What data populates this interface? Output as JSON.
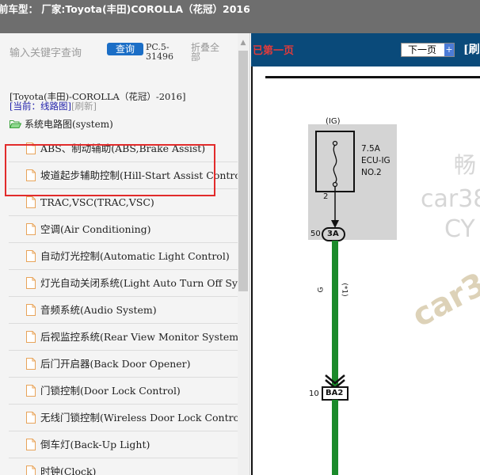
{
  "title": "前车型： 厂家:Toyota(丰田)COROLLA（花冠）2016",
  "search": {
    "placeholder": "输入关键字查询",
    "button": "查询",
    "pc_label": "PC.5-31496",
    "collapse_all": "折叠全部"
  },
  "breadcrumb": {
    "path": "[Toyota(丰田)-COROLLA（花冠）-2016]",
    "current": "[当前：线路图]",
    "refresh": "[刷新]"
  },
  "tree": {
    "root": "系统电路图(system)",
    "items": [
      "ABS、制动辅助(ABS,Brake Assist)",
      "坡道起步辅助控制(Hill-Start Assist Control)",
      "TRAC,VSC(TRAC,VSC)",
      "空调(Air Conditioning)",
      "自动灯光控制(Automatic Light Control)",
      "灯光自动关闭系统(Light Auto Turn Off System)",
      "音频系统(Audio System)",
      "后视监控系统(Rear View Monitor System)",
      "后门开启器(Back Door Opener)",
      "门锁控制(Door Lock Control)",
      "无线门锁控制(Wireless Door Lock Control)",
      "倒车灯(Back-Up Light)",
      "时钟(Clock)"
    ]
  },
  "viewer": {
    "prev_page": "已第一页",
    "next_page": "下一页",
    "edge_text": "[刷"
  },
  "diagram": {
    "source_label": "(IG)",
    "fuse_rating": "7.5A",
    "fuse_name": "ECU-IG",
    "fuse_no": "NO.2",
    "pin_top": "2",
    "connector1_pin": "50",
    "connector1": "3A",
    "wire_color": "G",
    "wire_note": "(*1)",
    "connector2_pin": "10",
    "connector2": "BA2"
  },
  "watermark": {
    "line1": "畅",
    "line2": "car38",
    "line3": "CY",
    "line4": "car3"
  },
  "colors": {
    "header_bg": "#0a4a7a",
    "button_blue": "#1b6ec6",
    "highlight_red": "#e22b2b",
    "wire_green": "#1a8a2a",
    "fuse_panel": "#d4d4d4"
  }
}
